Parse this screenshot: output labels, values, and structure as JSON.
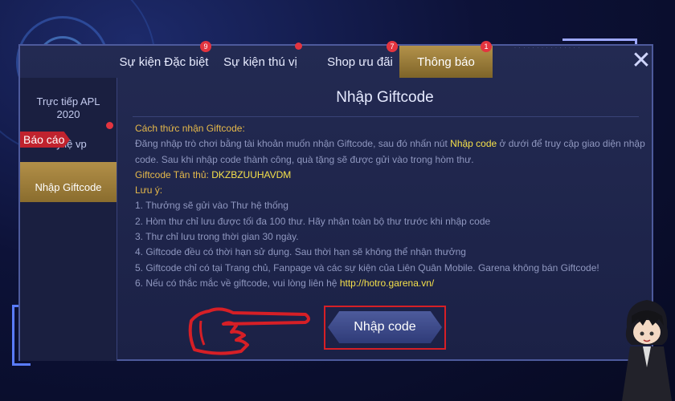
{
  "tabs": [
    {
      "label": "Sự kiện Đặc biệt",
      "badge": "9"
    },
    {
      "label": "Sự kiện thú vị",
      "badge": ""
    },
    {
      "label": "Shop ưu đãi",
      "badge": "7"
    },
    {
      "label": "Thông báo",
      "badge": "1",
      "active": true
    }
  ],
  "sidebar": {
    "items": [
      {
        "label": "Trực tiếp APL 2020"
      },
      {
        "label": "Tỷ lệ vp"
      },
      {
        "label": "Nhập Giftcode",
        "active": true
      }
    ],
    "report_tag": "Báo cáo"
  },
  "content": {
    "title": "Nhập Giftcode",
    "how_heading": "Cách thức nhận Giftcode:",
    "how_text_1": "Đăng nhập trò chơi bằng tài khoản muốn nhận Giftcode, sau đó nhấn nút ",
    "how_button_ref": "Nhập code",
    "how_text_2": " ở dưới để truy cập giao diện nhập code. Sau khi nhập code thành công, quà tặng sẽ được gửi vào trong hòm thư.",
    "newbie_label": "Giftcode Tân thủ:",
    "newbie_code": "DKZBZUUHAVDM",
    "notes_heading": "Lưu ý:",
    "notes": [
      "1. Thưởng sẽ gửi vào Thư hệ thống",
      "2. Hòm thư chỉ lưu được tối đa 100 thư. Hãy nhận toàn bộ thư trước khi nhập code",
      "3. Thư chỉ lưu trong thời gian 30 ngày.",
      "4. Giftcode đều có thời hạn sử dụng. Sau thời hạn sẽ không thể nhận thưởng",
      "5. Giftcode chỉ có tại Trang chủ, Fanpage và các sự kiện của Liên Quân Mobile. Garena không bán Giftcode!"
    ],
    "note6_text": "6. Nếu có thắc mắc về giftcode, vui lòng liên hệ ",
    "note6_link": "http://hotro.garena.vn/",
    "button_label": "Nhập code"
  },
  "icons": {
    "close": "close-icon",
    "pointer": "pointing-hand-icon",
    "avatar": "character-avatar"
  },
  "colors": {
    "accent_gold": "#b3924a",
    "highlight_yellow": "#f5e04a",
    "badge_red": "#e3343f",
    "frame_red": "#d61f26"
  }
}
